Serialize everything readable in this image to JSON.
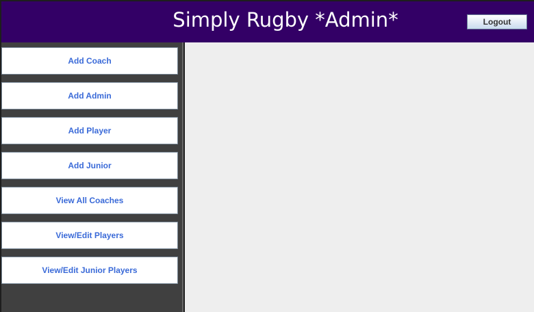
{
  "header": {
    "title": "Simply Rugby *Admin*",
    "logout_label": "Logout",
    "background_color": "#330066"
  },
  "sidebar": {
    "items": [
      {
        "label": "Add Coach"
      },
      {
        "label": "Add Admin"
      },
      {
        "label": "Add Player"
      },
      {
        "label": "Add Junior"
      },
      {
        "label": "View All Coaches"
      },
      {
        "label": "View/Edit Players"
      },
      {
        "label": "View/Edit Junior Players"
      }
    ],
    "text_color": "#3a6ad8"
  }
}
